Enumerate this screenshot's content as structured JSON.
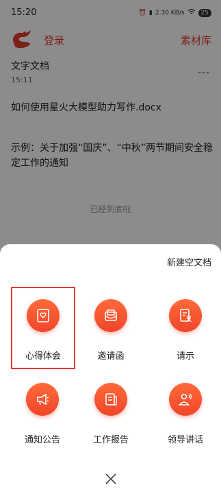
{
  "status_bar": {
    "time": "15:20",
    "net": "2.30 KB/s",
    "battery": "25"
  },
  "header": {
    "login_label": "登录",
    "library_label": "素材库"
  },
  "document": {
    "title": "文字文档",
    "time": "15:11",
    "more": "---",
    "lines": [
      "如何使用星火大模型助力写作.docx",
      "示例：关于加强“国庆”、“中秋”两节期间安全稳定工作的通知"
    ],
    "end_note": "已经到底啦"
  },
  "sheet": {
    "new_doc_label": "新建空文档",
    "templates": [
      {
        "label": "心得体会",
        "icon": "heart-document-icon",
        "selected": true
      },
      {
        "label": "邀请函",
        "icon": "envelope-icon"
      },
      {
        "label": "请示",
        "icon": "document-person-icon"
      },
      {
        "label": "通知公告",
        "icon": "megaphone-icon"
      },
      {
        "label": "工作报告",
        "icon": "report-icon"
      },
      {
        "label": "领导讲话",
        "icon": "speaker-icon"
      }
    ]
  },
  "colors": {
    "accent": "#e23b2e",
    "button_gradient_top": "#ff6a3a",
    "button_gradient_bottom": "#f0452a"
  }
}
